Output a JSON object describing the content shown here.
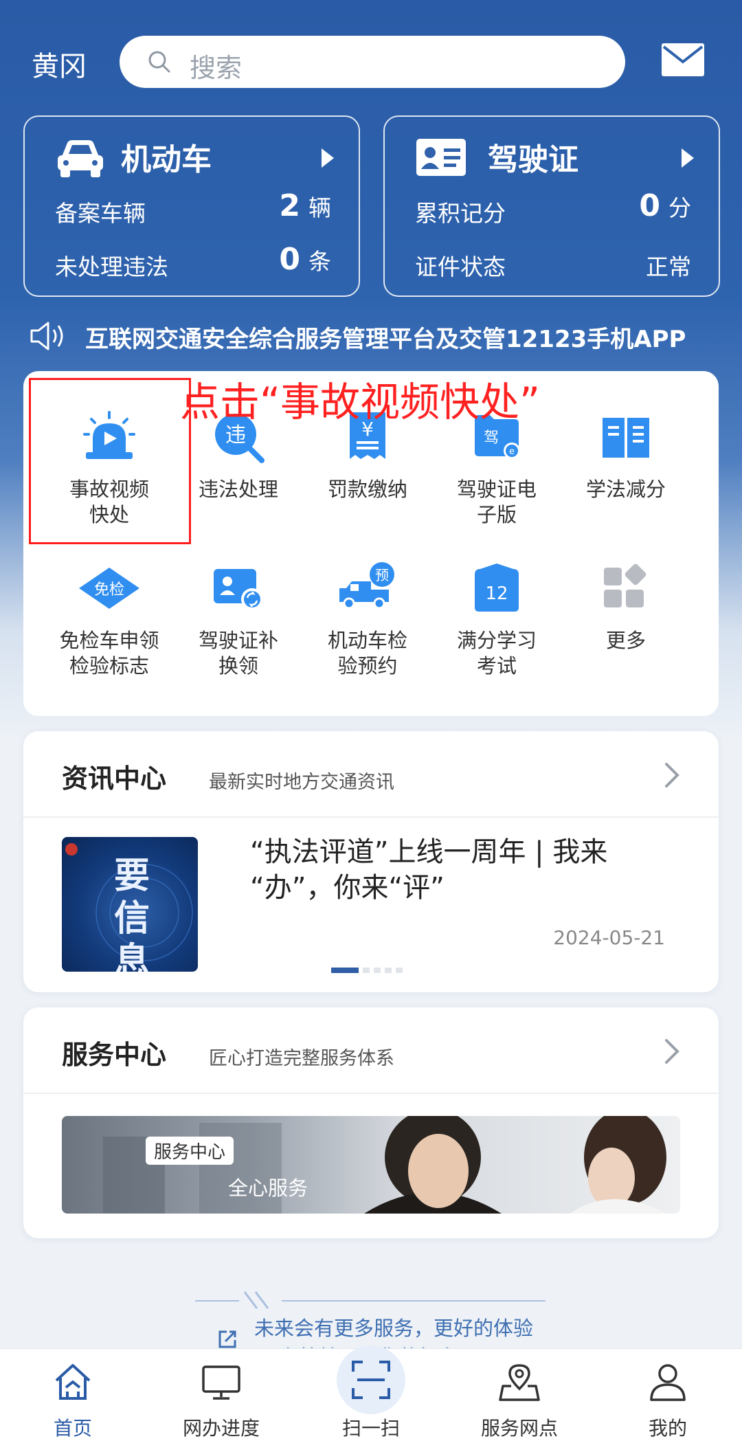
{
  "header": {
    "city": "黄冈",
    "search_placeholder": "搜索"
  },
  "vehicle_card": {
    "title": "机动车",
    "rows": [
      {
        "label": "备案车辆",
        "value": "2",
        "unit": "辆"
      },
      {
        "label": "未处理违法",
        "value": "0",
        "unit": "条"
      }
    ]
  },
  "license_card": {
    "title": "驾驶证",
    "rows": [
      {
        "label": "累积记分",
        "value": "0",
        "unit": "分"
      },
      {
        "label": "证件状态",
        "value": "正常",
        "unit": ""
      }
    ]
  },
  "marquee": {
    "text": "互联网交通安全综合服务管理平台及交管12123手机APP"
  },
  "annotation": "点击“事故视频快处”",
  "services": [
    {
      "label": "事故视频快处",
      "icon": "alarm-video-icon"
    },
    {
      "label": "违法处理",
      "icon": "violation-search-icon"
    },
    {
      "label": "罚款缴纳",
      "icon": "fine-receipt-icon"
    },
    {
      "label": "驾驶证电子版",
      "icon": "e-license-icon"
    },
    {
      "label": "学法减分",
      "icon": "book-icon"
    },
    {
      "label": "免检车申领检验标志",
      "icon": "inspection-exempt-icon"
    },
    {
      "label": "驾驶证补换领",
      "icon": "license-renew-icon"
    },
    {
      "label": "机动车检验预约",
      "icon": "truck-reserve-icon"
    },
    {
      "label": "满分学习考试",
      "icon": "calendar-exam-icon"
    },
    {
      "label": "更多",
      "icon": "more-grid-icon"
    }
  ],
  "services_display": {
    "s0_l1": "事故视频",
    "s0_l2": "快处",
    "s3_l1": "驾驶证电",
    "s3_l2": "子版",
    "s5_l1": "免检车申领",
    "s5_l2": "检验标志",
    "s6_l1": "驾驶证补",
    "s6_l2": "换领",
    "s7_l1": "机动车检",
    "s7_l2": "验预约",
    "s8_l1": "满分学习",
    "s8_l2": "考试"
  },
  "news": {
    "title": "资讯中心",
    "subtitle": "最新实时地方交通资讯",
    "item_title_l1": "“执法评道”上线一周年 | 我来",
    "item_title_l2": "“办”，你来“评”",
    "item_date": "2024-05-21",
    "thumb_text_l1": "要",
    "thumb_text_l2": "信息"
  },
  "service_center": {
    "title": "服务中心",
    "subtitle": "匠心打造完整服务体系",
    "banner_tag": "服务中心",
    "banner_slogan": "全心服务"
  },
  "footer_hint": {
    "line1": "未来会有更多服务，更好的体验",
    "line2": "现在快捷…给你的好车吧"
  },
  "tabs": [
    {
      "label": "首页",
      "active": true
    },
    {
      "label": "网办进度",
      "active": false
    },
    {
      "label": "扫一扫",
      "active": false
    },
    {
      "label": "服务网点",
      "active": false
    },
    {
      "label": "我的",
      "active": false
    }
  ],
  "colors": {
    "primary": "#2a5ba6",
    "icon_blue": "#2f8ef0",
    "annotation_red": "#ff2020"
  }
}
